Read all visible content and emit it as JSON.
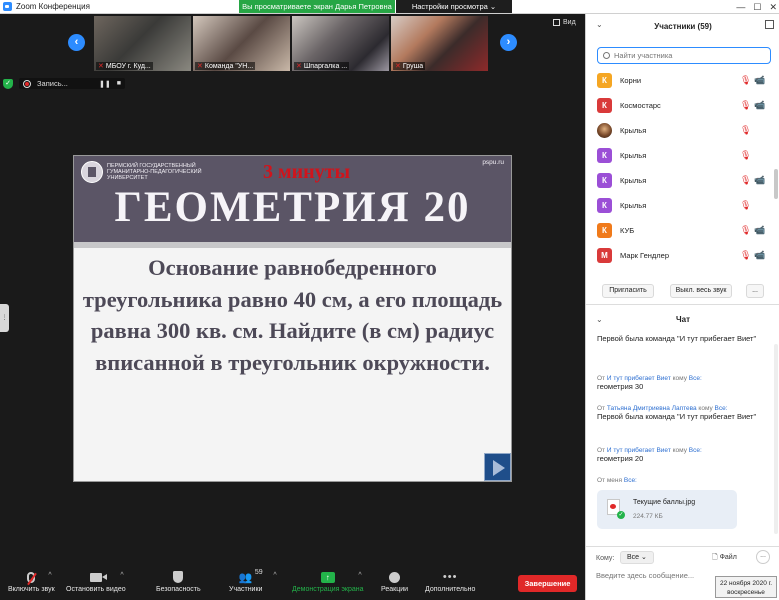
{
  "window": {
    "title": "Zoom Конференция",
    "share_banner": "Вы просматриваете экран Дарья Петровна",
    "view_settings": "Настройки просмотра",
    "view_label": "Вид"
  },
  "thumbnails": [
    {
      "label": "МБОУ г. Куд..."
    },
    {
      "label": "Команда \"УН..."
    },
    {
      "label": "Шпаргалка ..."
    },
    {
      "label": "Груша"
    }
  ],
  "recording": {
    "label": "Запись...",
    "pause": "❚❚",
    "stop": "■"
  },
  "slide": {
    "university": "Пермский государственный гуманитарно-педагогический университет",
    "timer": "3 минуты",
    "site": "pspu.ru",
    "title": "ГЕОМЕТРИЯ 20",
    "body": "Основание равнобедренного треугольника равно 40 см, а его площадь равна 300 кв. см. Найдите (в см) радиус вписанной в треугольник окружности."
  },
  "toolbar": {
    "mute": "Включить звук",
    "video": "Остановить видео",
    "security": "Безопасность",
    "participants": "Участники",
    "participants_count": "59",
    "share": "Демонстрация экрана",
    "reactions": "Реакции",
    "more": "Дополнительно",
    "end": "Завершение"
  },
  "participants_panel": {
    "title": "Участники (59)",
    "search_placeholder": "Найти участника",
    "people": [
      {
        "initial": "К",
        "name": "Корни",
        "color": "#f5a623",
        "photo": false,
        "video_off": true
      },
      {
        "initial": "К",
        "name": "Космостарс",
        "color": "#d93a3a",
        "photo": false,
        "video_off": true
      },
      {
        "initial": "",
        "name": "Крылья",
        "color": "#8a5a3a",
        "photo": true,
        "video_off": false
      },
      {
        "initial": "К",
        "name": "Крылья",
        "color": "#9b4fd6",
        "photo": false,
        "video_off": false
      },
      {
        "initial": "К",
        "name": "Крылья",
        "color": "#9b4fd6",
        "photo": false,
        "video_off": true
      },
      {
        "initial": "К",
        "name": "Крылья",
        "color": "#9b4fd6",
        "photo": false,
        "video_off": false
      },
      {
        "initial": "К",
        "name": "КУБ",
        "color": "#f07a1a",
        "photo": false,
        "video_off": true
      },
      {
        "initial": "М",
        "name": "Марк Гендлер",
        "color": "#d93a3a",
        "photo": false,
        "video_off": true
      }
    ],
    "invite": "Пригласить",
    "mute_all": "Выкл. весь звук",
    "more": "..."
  },
  "chat": {
    "title": "Чат",
    "messages": [
      {
        "meta_prefix": "",
        "sender": "",
        "meta_mid": "",
        "to": "",
        "text": "Первой была команда \"И тут прибегает Виет\""
      },
      {
        "meta_prefix": "От ",
        "sender": "И тут прибегает Виет",
        "meta_mid": " кому ",
        "to": "Все:",
        "text": "геометрия 30"
      },
      {
        "meta_prefix": "От ",
        "sender": "Татьяна Дмитриевна Лаптева",
        "meta_mid": " кому ",
        "to": "Все:",
        "text": "Первой была команда \"И тут прибегает Виет\""
      },
      {
        "meta_prefix": "От ",
        "sender": "И тут прибегает Виет",
        "meta_mid": " кому ",
        "to": "Все:",
        "text": "геометрия 20"
      }
    ],
    "me_meta": "От меня",
    "me_to": "Все:",
    "file_name": "Текущие баллы.jpg",
    "file_size": "224.77 КБ",
    "to_label": "Кому:",
    "to_value": "Все",
    "file_button": "Файл",
    "more": "...",
    "input_placeholder": "Введите здесь сообщение..."
  },
  "clock": {
    "date": "22 ноября 2020 г.",
    "day": "воскресенье"
  }
}
